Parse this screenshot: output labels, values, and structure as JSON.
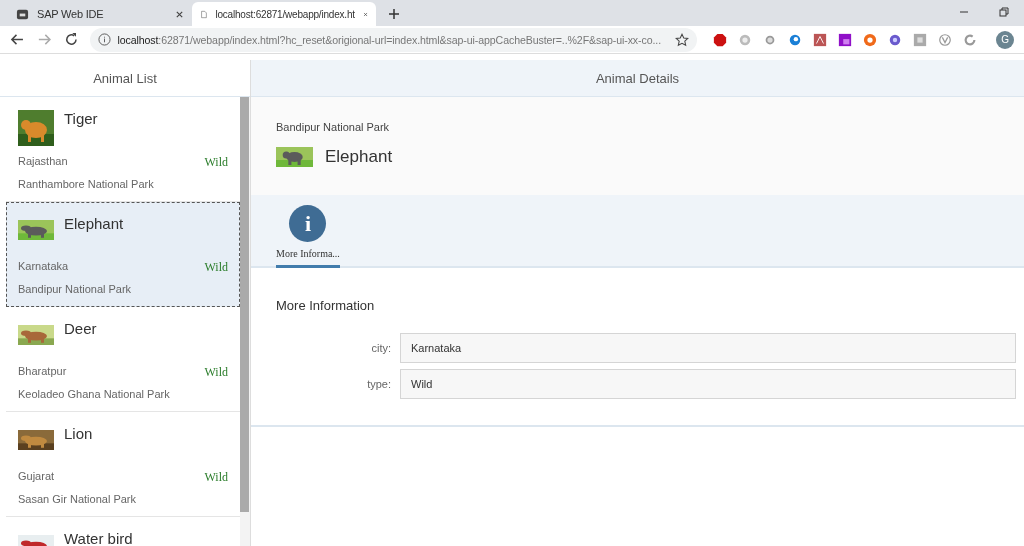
{
  "browser": {
    "tabs": [
      {
        "title": "SAP Web IDE",
        "selected": false
      },
      {
        "title": "localhost:62871/webapp/index.ht",
        "selected": true
      }
    ],
    "address": {
      "host": "localhost",
      "rest": ":62871/webapp/index.html?hc_reset&origional-url=index.html&sap-ui-appCacheBuster=..%2F&sap-ui-xx-co..."
    },
    "avatar": "G"
  },
  "master": {
    "title": "Animal List",
    "items": [
      {
        "name": "Tiger",
        "city": "Rajasthan",
        "type": "Wild",
        "park": "Ranthambore National Park",
        "selected": false
      },
      {
        "name": "Elephant",
        "city": "Karnataka",
        "type": "Wild",
        "park": "Bandipur National Park",
        "selected": true
      },
      {
        "name": "Deer",
        "city": "Bharatpur",
        "type": "Wild",
        "park": "Keoladeo Ghana National Park",
        "selected": false
      },
      {
        "name": "Lion",
        "city": "Gujarat",
        "type": "Wild",
        "park": "Sasan Gir National Park",
        "selected": false
      },
      {
        "name": "Water bird",
        "selected": false
      }
    ]
  },
  "detail": {
    "title": "Animal Details",
    "subtitle": "Bandipur National Park",
    "name": "Elephant",
    "tabs": [
      {
        "glyph": "i",
        "label": "More Informa...",
        "selected": true
      }
    ],
    "section": "More Information",
    "fields": [
      {
        "label": "city:",
        "value": "Karnataka"
      },
      {
        "label": "type:",
        "value": "Wild"
      }
    ]
  }
}
